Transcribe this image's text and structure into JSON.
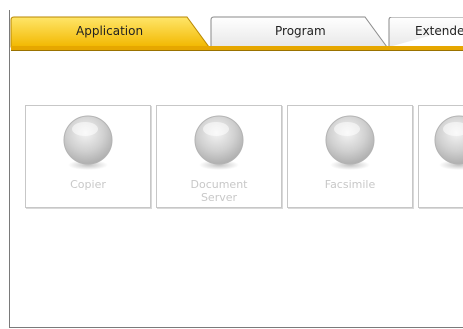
{
  "tabs": [
    {
      "label": "Application",
      "active": true
    },
    {
      "label": "Program",
      "active": false
    },
    {
      "label": "Extende",
      "active": false
    }
  ],
  "apps": [
    {
      "label": "Copier"
    },
    {
      "label": "Document\nServer"
    },
    {
      "label": "Facsimile"
    },
    {
      "label": ""
    }
  ],
  "colors": {
    "active_tab": "#f5c400",
    "tab_rule": "#e6a700",
    "inactive_tab": "#ffffff",
    "disabled_text": "#c8c8c8"
  }
}
